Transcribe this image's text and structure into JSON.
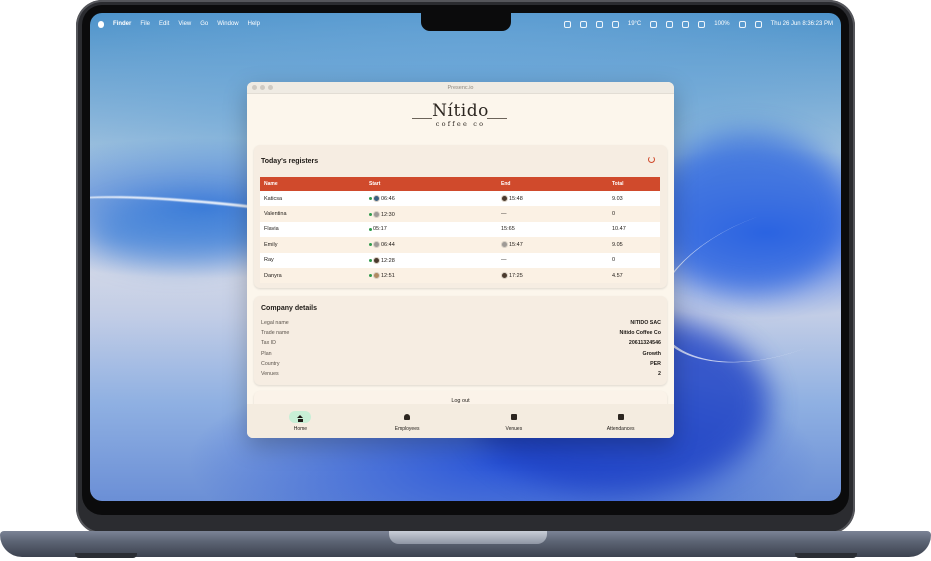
{
  "menubar": {
    "left": [
      "Finder",
      "File",
      "Edit",
      "View",
      "Go",
      "Window",
      "Help"
    ],
    "weather": "19°C",
    "battery": "100%",
    "datetime": "Thu 26 Jun  8:36:23 PM"
  },
  "window": {
    "title": "Presenc.io",
    "logo": {
      "brand": "Nítido",
      "sub": "coffee co"
    }
  },
  "registers": {
    "title": "Today's registers",
    "columns": [
      "Name",
      "Start",
      "End",
      "Total"
    ],
    "rows": [
      {
        "name": "Katicsa",
        "start": "06:46",
        "end": "15:48",
        "total": "9.03"
      },
      {
        "name": "Valentina",
        "start": "12:30",
        "end": "—",
        "total": "0"
      },
      {
        "name": "Flavia",
        "start": "05:17",
        "end": "15:65",
        "total": "10.47"
      },
      {
        "name": "Emily",
        "start": "06:44",
        "end": "15:47",
        "total": "9.05"
      },
      {
        "name": "Ray",
        "start": "12:28",
        "end": "—",
        "total": "0"
      },
      {
        "name": "Danyra",
        "start": "12:51",
        "end": "17:25",
        "total": "4.57"
      }
    ]
  },
  "company": {
    "title": "Company details",
    "fields": [
      {
        "label": "Legal name",
        "value": "NITIDO SAC"
      },
      {
        "label": "Trade name",
        "value": "Nitido Coffee Co"
      },
      {
        "label": "Tax ID",
        "value": "20611324546"
      },
      {
        "label": "Plan",
        "value": "Growth"
      },
      {
        "label": "Country",
        "value": "PER"
      },
      {
        "label": "Venues",
        "value": "2"
      }
    ]
  },
  "logout_label": "Log out",
  "tabs": [
    {
      "label": "Home",
      "icon": "home-icon",
      "active": true
    },
    {
      "label": "Employees",
      "icon": "people-icon",
      "active": false
    },
    {
      "label": "Venues",
      "icon": "store-icon",
      "active": false
    },
    {
      "label": "Attendances",
      "icon": "calendar-icon",
      "active": false
    }
  ]
}
